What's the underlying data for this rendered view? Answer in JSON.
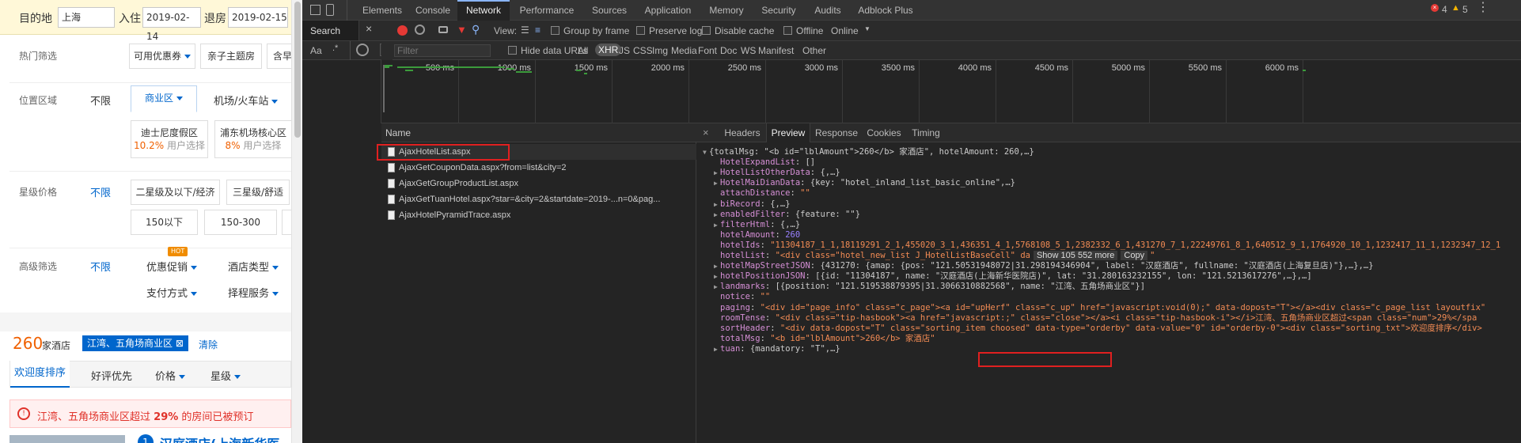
{
  "left": {
    "dest_label": "目的地",
    "dest_value": "上海",
    "checkin_label": "入住",
    "checkin_value": "2019-02-14",
    "checkout_label": "退房",
    "checkout_value": "2019-02-15",
    "hot_label": "热门筛选",
    "hot_opts": [
      "可用优惠券",
      "亲子主题房",
      "含早"
    ],
    "loc_label": "位置区域",
    "loc_nolimit": "不限",
    "loc_tab1": "商业区",
    "loc_tab2": "机场/火车站",
    "loc_cards": [
      {
        "name": "迪士尼度假区",
        "pct": "10.2%",
        "sub": "用户选择"
      },
      {
        "name": "浦东机场核心区",
        "pct": "8%",
        "sub": "用户选择"
      }
    ],
    "star_label": "星级价格",
    "star_nolimit": "不限",
    "star_opts": [
      "二星级及以下/经济",
      "三星级/舒适",
      "150以下",
      "150-300"
    ],
    "adv_label": "高级筛选",
    "adv_nolimit": "不限",
    "adv_hot_badge": "HOT",
    "adv_opts": [
      "优惠促销",
      "酒店类型",
      "支付方式",
      "择程服务"
    ],
    "count_num": "260",
    "count_suffix": "家酒店",
    "tag": "江湾、五角场商业区",
    "clear": "清除",
    "sorts": [
      "欢迎度排序",
      "好评优先",
      "价格",
      "星级"
    ],
    "alert_pre": "江湾、五角场商业区超过",
    "alert_pct": "29%",
    "alert_post": "的房间已被预订",
    "first_num": "1",
    "first_hotel": "汉庭酒店(上海新华医"
  },
  "devtools": {
    "tabs": [
      "Elements",
      "Console",
      "Network",
      "Performance",
      "Sources",
      "Application",
      "Memory",
      "Security",
      "Audits",
      "Adblock Plus"
    ],
    "active_tab": "Network",
    "errors": "4",
    "warnings": "5",
    "search_label": "Search",
    "view_label": "View:",
    "group_by_frame": "Group by frame",
    "preserve_log": "Preserve log",
    "disable_cache": "Disable cache",
    "offline": "Offline",
    "online": "Online",
    "aa": "Aa",
    "filter_placeholder": "Filter",
    "hide_data_urls": "Hide data URLs",
    "types": [
      "All",
      "XHR",
      "JS",
      "CSS",
      "Img",
      "Media",
      "Font",
      "Doc",
      "WS",
      "Manifest",
      "Other"
    ],
    "active_type": "XHR",
    "timeline_ticks": [
      "500 ms",
      "1000 ms",
      "1500 ms",
      "2000 ms",
      "2500 ms",
      "3000 ms",
      "3500 ms",
      "4000 ms",
      "4500 ms",
      "5000 ms",
      "5500 ms",
      "6000 ms"
    ],
    "name_header": "Name",
    "requests": [
      "AjaxHotelList.aspx",
      "AjaxGetCouponData.aspx?from=list&city=2",
      "AjaxGetGroupProductList.aspx",
      "AjaxGetTuanHotel.aspx?star=&city=2&startdate=2019-...n=0&pag...",
      "AjaxHotelPyramidTrace.aspx"
    ],
    "detail_tabs": [
      "Headers",
      "Preview",
      "Response",
      "Cookies",
      "Timing"
    ],
    "active_detail_tab": "Preview",
    "json_lines": [
      {
        "tri": "▼",
        "ind": 0,
        "k": "",
        "v": "{totalMsg: \"<b id=\"lblAmount\">260</b> 家酒店\", hotelAmount: 260,…}",
        "c": "p"
      },
      {
        "tri": "",
        "ind": 1,
        "k": "HotelExpandList",
        "v": "[]",
        "c": "p"
      },
      {
        "tri": "▶",
        "ind": 1,
        "k": "HotelListOtherData",
        "v": "{,…}",
        "c": "p"
      },
      {
        "tri": "▶",
        "ind": 1,
        "k": "HotelMaiDianData",
        "v": "{key: \"hotel_inland_list_basic_online\",…}",
        "c": "p"
      },
      {
        "tri": "",
        "ind": 1,
        "k": "attachDistance",
        "v": "\"\"",
        "c": "s"
      },
      {
        "tri": "▶",
        "ind": 1,
        "k": "biRecord",
        "v": "{,…}",
        "c": "p"
      },
      {
        "tri": "▶",
        "ind": 1,
        "k": "enabledFilter",
        "v": "{feature: \"\"}",
        "c": "p"
      },
      {
        "tri": "▶",
        "ind": 1,
        "k": "filterHtml",
        "v": "{,…}",
        "c": "p"
      },
      {
        "tri": "",
        "ind": 1,
        "k": "hotelAmount",
        "v": "260",
        "c": "n"
      },
      {
        "tri": "",
        "ind": 1,
        "k": "hotelIds",
        "v": "\"11304187_1_1,18119291_2_1,455020_3_1,436351_4_1,5768108_5_1,2382332_6_1,431270_7_1,22249761_8_1,640512_9_1,1764920_10_1,1232417_11_1,1232347_12_1",
        "c": "s"
      },
      {
        "tri": "",
        "ind": 1,
        "k": "hotelList",
        "v": "\"<div class=\"hotel_new_list J_HotelListBaseCell\" da",
        "c": "s",
        "extra": true
      },
      {
        "tri": "▶",
        "ind": 1,
        "k": "hotelMapStreetJSON",
        "v": "{431270: {amap: {pos: \"121.50531948072|31.298194346904\", label: \"汉庭酒店\", fullname: \"汉庭酒店(上海复旦店)\"},…},…}",
        "c": "p"
      },
      {
        "tri": "▶",
        "ind": 1,
        "k": "hotelPositionJSON",
        "v": "[{id: \"11304187\", name: \"汉庭酒店(上海新华医院店)\", lat: \"31.280163232155\", lon: \"121.5213617276\",…},…]",
        "c": "p"
      },
      {
        "tri": "▶",
        "ind": 1,
        "k": "landmarks",
        "v": "[{position: \"121.519538879395|31.3066310882568\", name: \"江湾、五角场商业区\"}]",
        "c": "p"
      },
      {
        "tri": "",
        "ind": 1,
        "k": "notice",
        "v": "\"\"",
        "c": "s"
      },
      {
        "tri": "",
        "ind": 1,
        "k": "paging",
        "v": "\"<div id=\"page_info\" class=\"c_page\"><a id=\"upHerf\" class=\"c_up\" href=\"javascript:void(0);\" data-dopost=\"T\"></a><div class=\"c_page_list layoutfix\"",
        "c": "s"
      },
      {
        "tri": "",
        "ind": 1,
        "k": "roomTense",
        "v": "\"<div class=\"tip-hasbook\"><a href=\"javascript:;\" class=\"close\"></a><i class=\"tip-hasbook-i\"></i>江湾、五角场商业区超过<span class=\"num\">29%</spa",
        "c": "s"
      },
      {
        "tri": "",
        "ind": 1,
        "k": "sortHeader",
        "v": "\"<div data-dopost=\"T\" class=\"sorting_item choosed\" data-type=\"orderby\" data-value=\"0\" id=\"orderby-0\"><div class=\"sorting_txt\">欢迎度排序</div>",
        "c": "s"
      },
      {
        "tri": "",
        "ind": 1,
        "k": "totalMsg",
        "v": "\"<b id=\"lblAmount\">260</b> 家酒店\"",
        "c": "s"
      },
      {
        "tri": "▶",
        "ind": 1,
        "k": "tuan",
        "v": "{mandatory: \"T\",…}",
        "c": "p"
      }
    ],
    "show_more": "Show 105 552 more",
    "copy": "Copy",
    "close_quote": "\""
  }
}
